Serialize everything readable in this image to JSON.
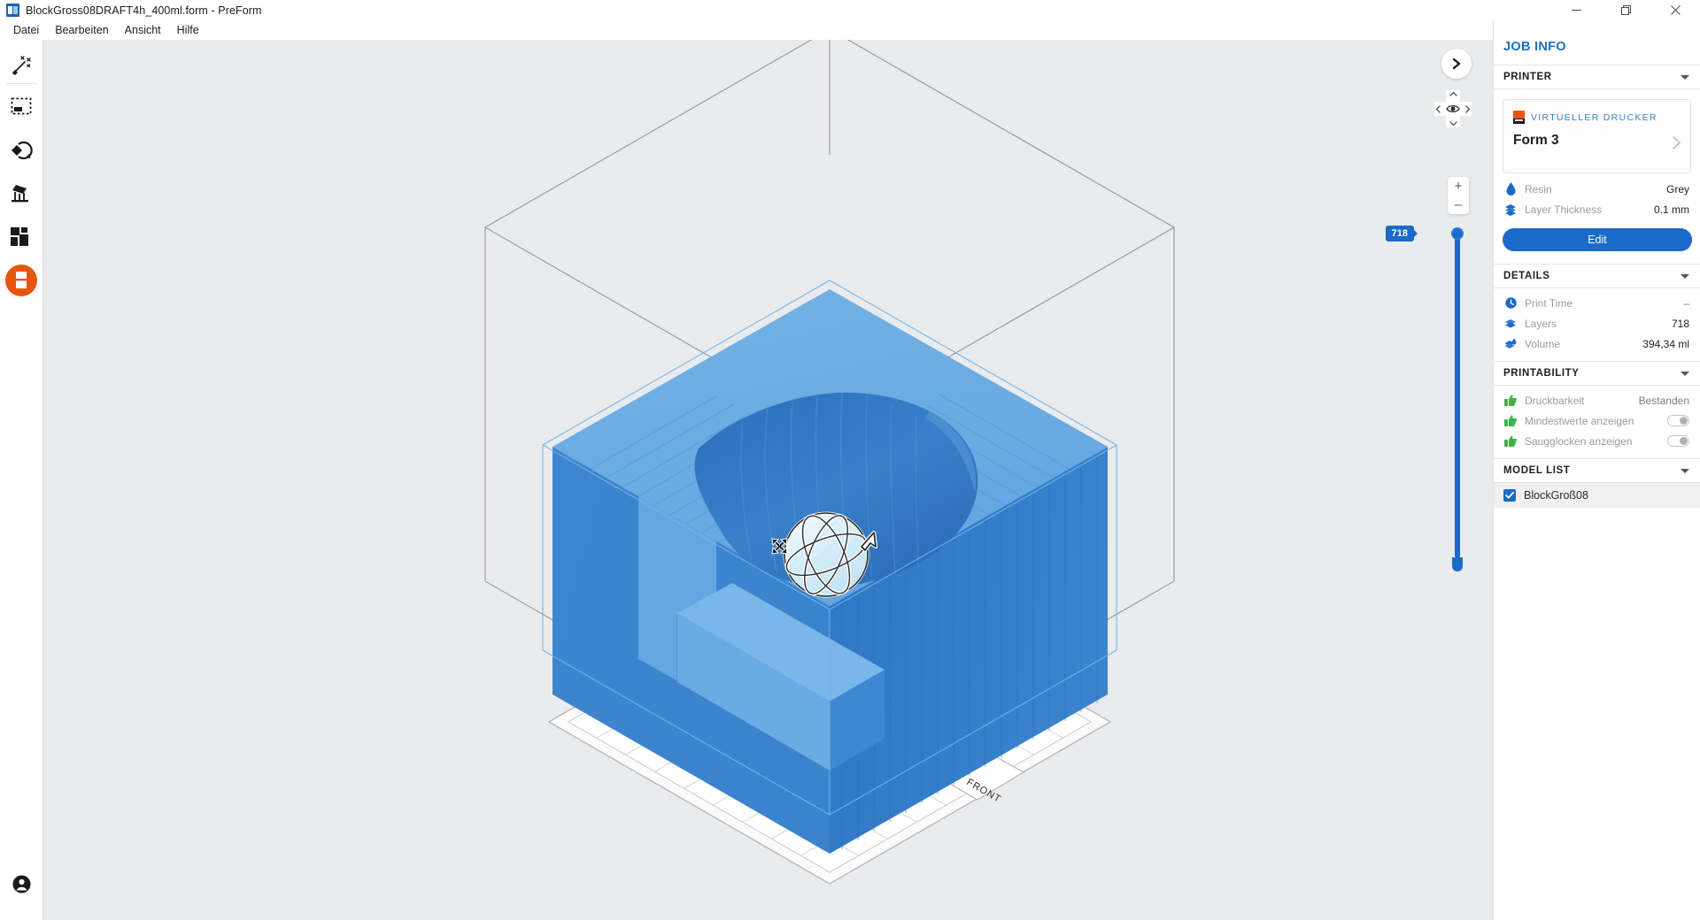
{
  "window": {
    "title": "BlockGross08DRAFT4h_400ml.form - PreForm",
    "app_icon": "preform-app-icon",
    "minimize_label": "—",
    "maximize_label": "❐",
    "close_label": "✕"
  },
  "menubar": {
    "items": [
      {
        "label": "Datei"
      },
      {
        "label": "Bearbeiten"
      },
      {
        "label": "Ansicht"
      },
      {
        "label": "Hilfe"
      }
    ]
  },
  "toolbar": {
    "items": [
      {
        "name": "magic-wand-tool",
        "label": "Magic Wand"
      },
      {
        "name": "select-tool",
        "label": "Select"
      },
      {
        "name": "orient-tool",
        "label": "Orient"
      },
      {
        "name": "supports-tool",
        "label": "Supports"
      },
      {
        "name": "layout-tool",
        "label": "Layout"
      },
      {
        "name": "print-tool",
        "label": "Print",
        "active": true
      }
    ],
    "account_label": "Account"
  },
  "viewport": {
    "front_label": "FRONT",
    "nav": {
      "expand_label": "›",
      "pan_up": "⌃",
      "pan_down": "⌄",
      "pan_left": "‹",
      "pan_right": "›",
      "home_icon": "eye-icon",
      "zoom_in": "+",
      "zoom_out": "–"
    },
    "layer_slider": {
      "value": "718",
      "max": "718",
      "min": "1"
    },
    "gizmo": {
      "scale_icon": "scale-arrows-icon",
      "move_icon": "move-arrow-icon",
      "sphere_icon": "orientation-sphere-icon"
    }
  },
  "panel": {
    "title": "JOB INFO",
    "printer": {
      "header": "PRINTER",
      "kind": "VIRTUELLER DRUCKER",
      "name": "Form 3",
      "chevron": "›",
      "rows": [
        {
          "icon": "resin-drop-icon",
          "label": "Resin",
          "value": "Grey"
        },
        {
          "icon": "layer-thickness-icon",
          "label": "Layer Thickness",
          "value": "0.1 mm"
        }
      ],
      "edit_label": "Edit"
    },
    "details": {
      "header": "DETAILS",
      "rows": [
        {
          "icon": "clock-icon",
          "label": "Print Time",
          "value": "–"
        },
        {
          "icon": "layers-icon",
          "label": "Layers",
          "value": "718"
        },
        {
          "icon": "volume-icon",
          "label": "Volume",
          "value": "394,34 ml"
        }
      ]
    },
    "printability": {
      "header": "PRINTABILITY",
      "rows": [
        {
          "icon": "thumbs-up-icon",
          "label": "Druckbarkeit",
          "value": "Bestanden",
          "toggle": false
        },
        {
          "icon": "thumbs-up-icon",
          "label": "Mindestwerte anzeigen",
          "value": "",
          "toggle": true
        },
        {
          "icon": "thumbs-up-icon",
          "label": "Saugglocken anzeigen",
          "value": "",
          "toggle": true
        }
      ]
    },
    "model_list": {
      "header": "MODEL LIST",
      "items": [
        {
          "name": "BlockGroß08",
          "checked": true
        }
      ]
    }
  },
  "colors": {
    "accent_blue": "#1b6ac9",
    "accent_orange": "#e8550f",
    "model_blue": "#3e8fd8",
    "viewport_bg": "#eaebec",
    "green_ok": "#3ab54a"
  }
}
